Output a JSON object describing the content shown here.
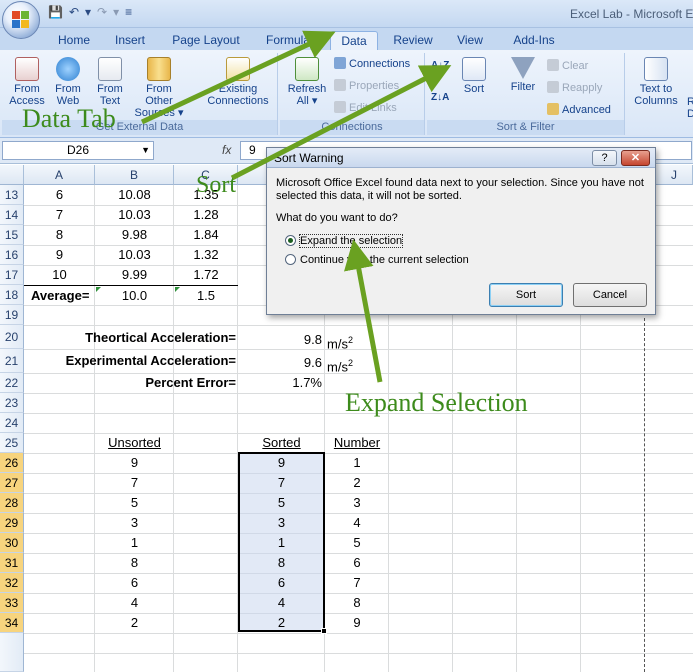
{
  "app": {
    "title": "Excel Lab - Microsoft Ex",
    "qat": [
      "💾",
      "↶",
      "▾",
      "↷",
      "▾",
      "≡"
    ]
  },
  "tabs": [
    {
      "label": "Home",
      "active": false
    },
    {
      "label": "Insert",
      "active": false
    },
    {
      "label": "Page Layout",
      "active": false
    },
    {
      "label": "Formulas",
      "active": false
    },
    {
      "label": "Data",
      "active": true
    },
    {
      "label": "Review",
      "active": false
    },
    {
      "label": "View",
      "active": false
    },
    {
      "label": "Add-Ins",
      "active": false
    }
  ],
  "ribbon": {
    "get_external": {
      "label": "Get External Data",
      "from_access": [
        "From",
        "Access"
      ],
      "from_web": [
        "From",
        "Web"
      ],
      "from_text": [
        "From",
        "Text"
      ],
      "from_other": [
        "From Other",
        "Sources ▾"
      ],
      "existing": [
        "Existing",
        "Connections"
      ]
    },
    "connections": {
      "label": "Connections",
      "refresh": [
        "Refresh",
        "All ▾"
      ],
      "connections": "Connections",
      "properties": "Properties",
      "edit_links": "Edit Links"
    },
    "sort_filter": {
      "label": "Sort & Filter",
      "sort": "Sort",
      "filter": "Filter",
      "clear": "Clear",
      "reapply": "Reapply",
      "advanced": "Advanced",
      "az": "A↓Z",
      "za": "Z↓A"
    },
    "data_tools": {
      "text_to_columns": [
        "Text to",
        "Columns"
      ],
      "partial": [
        "R",
        "D"
      ]
    }
  },
  "formula_bar": {
    "name_box": "D26",
    "fx": "fx",
    "value": "9"
  },
  "columns": [
    "A",
    "B",
    "C",
    "J"
  ],
  "rows": [
    "13",
    "14",
    "15",
    "16",
    "17",
    "18",
    "19",
    "20",
    "21",
    "22",
    "23",
    "24",
    "25",
    "26",
    "27",
    "28",
    "29",
    "30",
    "31",
    "32",
    "33",
    "34"
  ],
  "data_rows": [
    {
      "a": "6",
      "b": "10.08",
      "c": "1.35"
    },
    {
      "a": "7",
      "b": "10.03",
      "c": "1.28"
    },
    {
      "a": "8",
      "b": "9.98",
      "c": "1.84"
    },
    {
      "a": "9",
      "b": "10.03",
      "c": "1.32"
    },
    {
      "a": "10",
      "b": "9.99",
      "c": "1.72"
    }
  ],
  "average": {
    "label": "Average=",
    "b": "10.0",
    "c": "1.5"
  },
  "results": {
    "theoretical_label": "Theortical Acceleration=",
    "theoretical_value": "9.8",
    "theoretical_unit": "m/s",
    "experimental_label": "Experimental Acceleration=",
    "experimental_value": "9.6",
    "experimental_unit": "m/s",
    "unit_exp": "2",
    "percent_label": "Percent Error=",
    "percent_value": "1.7%"
  },
  "sort_table": {
    "headers": {
      "unsorted": "Unsorted",
      "sorted": "Sorted",
      "number": "Number"
    },
    "unsorted": [
      "9",
      "7",
      "5",
      "3",
      "1",
      "8",
      "6",
      "4",
      "2"
    ],
    "sorted": [
      "9",
      "7",
      "5",
      "3",
      "1",
      "8",
      "6",
      "4",
      "2"
    ],
    "number": [
      "1",
      "2",
      "3",
      "4",
      "5",
      "6",
      "7",
      "8",
      "9"
    ]
  },
  "dialog": {
    "title": "Sort Warning",
    "help": "?",
    "close": "✕",
    "message": "Microsoft Office Excel found data next to your selection.  Since you have not selected this data, it will not be sorted.",
    "question": "What do you want to do?",
    "option_expand": "Expand the selection",
    "option_continue": "Continue with the current selection",
    "selected_option": "expand",
    "sort_button": "Sort",
    "cancel_button": "Cancel"
  },
  "annotations": {
    "data_tab": "Data Tab",
    "sort": "Sort",
    "expand": "Expand Selection",
    "color": "#3d8b1c"
  }
}
